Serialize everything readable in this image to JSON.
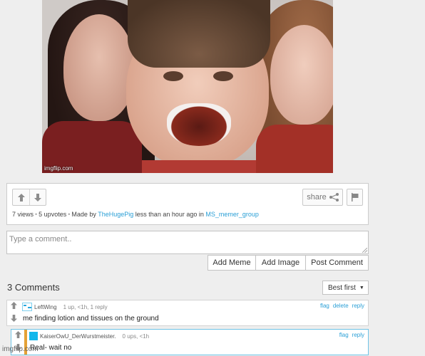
{
  "meme": {
    "watermark": "imgflip.com"
  },
  "post": {
    "upvote_icon": "arrow-up-icon",
    "downvote_icon": "arrow-down-icon",
    "share_label": "share",
    "stats": {
      "views": "7 views",
      "upvotes": "5 upvotes",
      "made_by_prefix": "Made by",
      "author": "TheHugePig",
      "time": "less than an hour ago in",
      "stream": "MS_memer_group"
    }
  },
  "comment_form": {
    "placeholder": "Type a comment..",
    "buttons": [
      "Add Meme",
      "Add Image",
      "Post Comment"
    ]
  },
  "comments_header": {
    "title": "3 Comments",
    "sort_label": "Best first"
  },
  "comments": [
    {
      "user": "LeftWing",
      "meta": "1 up, <1h, 1 reply",
      "links": [
        "flag",
        "delete",
        "reply"
      ],
      "text": "me finding lotion and tissues on the ground"
    },
    {
      "user": "KaiserOwU_DerWurstmeister.",
      "meta": "0 ups, <1h",
      "links": [
        "flag",
        "reply"
      ],
      "text": "Real- wait no"
    }
  ],
  "footer": {
    "watermark": "imgflip.com"
  },
  "colors": {
    "link": "#2a9fd6",
    "reply_accent": "#e5a236",
    "highlight_border": "#6fc3e6"
  }
}
